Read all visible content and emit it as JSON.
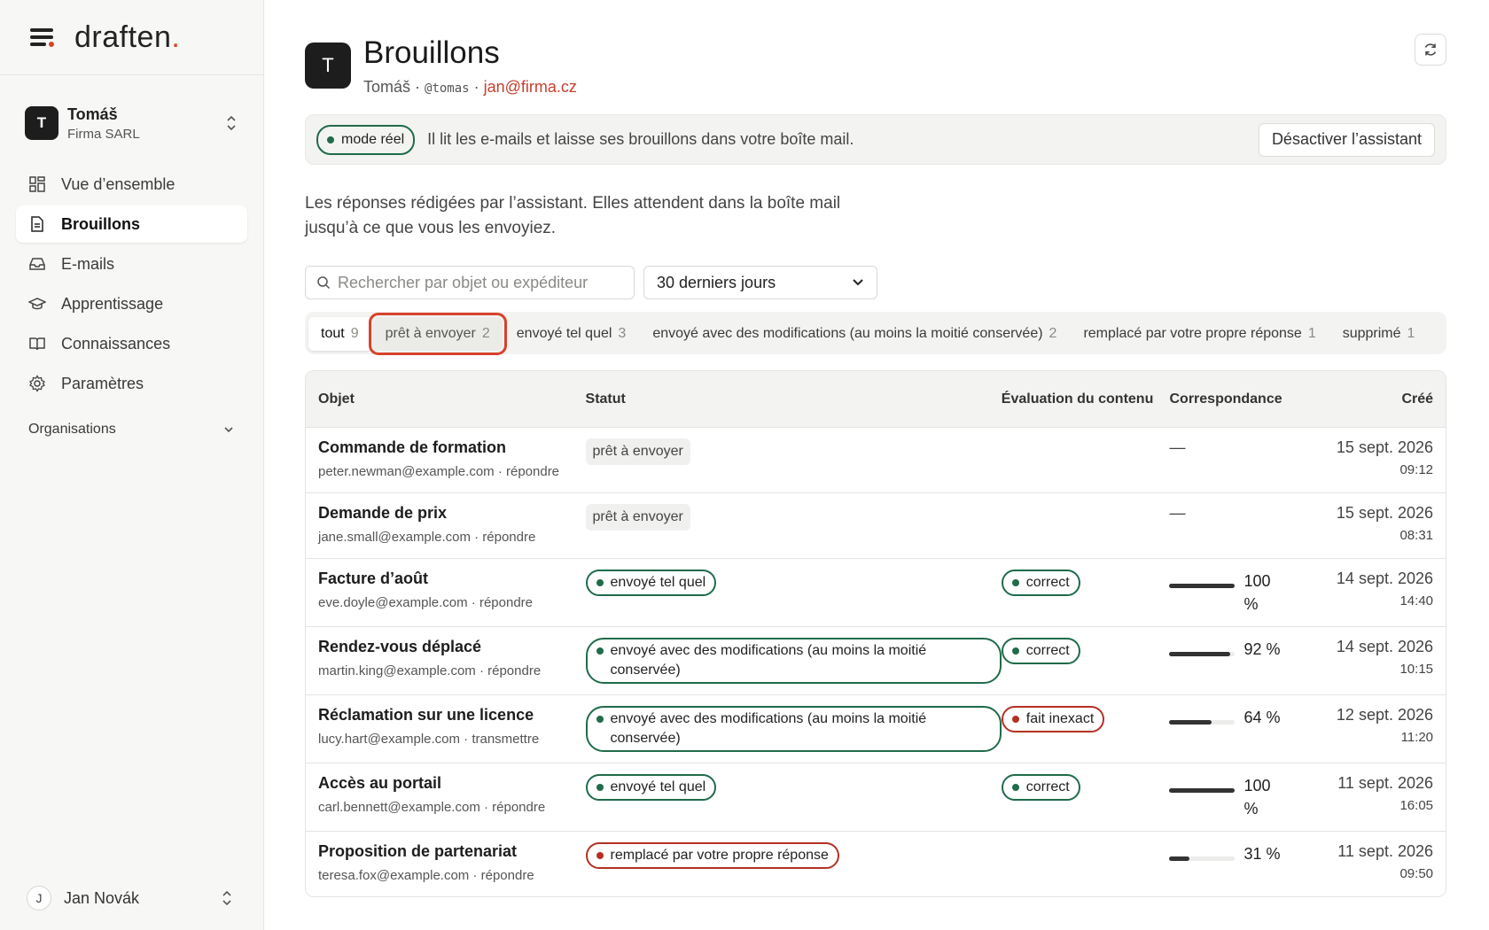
{
  "brand": {
    "name": "draften",
    "dot": ".",
    "accent": "#d8422b"
  },
  "account": {
    "initial": "T",
    "name": "Tomáš",
    "org": "Firma SARL"
  },
  "nav": [
    {
      "label": "Vue d’ensemble",
      "icon": "grid-icon"
    },
    {
      "label": "Brouillons",
      "icon": "document-icon",
      "active": true
    },
    {
      "label": "E-mails",
      "icon": "inbox-icon"
    },
    {
      "label": "Apprentissage",
      "icon": "graduation-cap-icon"
    },
    {
      "label": "Connaissances",
      "icon": "book-icon"
    },
    {
      "label": "Paramètres",
      "icon": "gear-icon"
    }
  ],
  "organisations_label": "Organisations",
  "user": {
    "initial": "J",
    "name": "Jan Novák"
  },
  "header": {
    "initial": "T",
    "title": "Brouillons",
    "name": "Tomáš",
    "sep1": " · ",
    "handle": "@tomas",
    "sep2": " · ",
    "email": "jan@firma.cz"
  },
  "mode_bar": {
    "pill": "mode réel",
    "description": "Il lit les e-mails et laisse ses brouillons dans votre boîte mail.",
    "button": "Désactiver l’assistant"
  },
  "intro": "Les réponses rédigées par l’assistant. Elles attendent dans la boîte mail jusqu’à ce que vous les envoyiez.",
  "search": {
    "placeholder": "Rechercher par objet ou expéditeur"
  },
  "period": {
    "value": "30 derniers jours"
  },
  "tabs": [
    {
      "label": "tout",
      "count": "9"
    },
    {
      "label": "prêt à envoyer",
      "count": "2"
    },
    {
      "label": "envoyé tel quel",
      "count": "3"
    },
    {
      "label": "envoyé avec des modifications (au moins la moitié conservée)",
      "count": "2"
    },
    {
      "label": "remplacé par votre propre réponse",
      "count": "1"
    },
    {
      "label": "supprimé",
      "count": "1"
    }
  ],
  "table": {
    "headers": [
      "Objet",
      "Statut",
      "Évaluation du contenu",
      "Correspondance",
      "Créé"
    ],
    "rows": [
      {
        "subject": "Commande de formation",
        "sender": "peter.newman@example.com · répondre",
        "status": "prêt à envoyer",
        "eval": "",
        "match": "—",
        "match_value": null,
        "date": "15 sept. 2026",
        "time": "09:12"
      },
      {
        "subject": "Demande de prix",
        "sender": "jane.small@example.com · répondre",
        "status": "prêt à envoyer",
        "eval": "",
        "match": "—",
        "match_value": null,
        "date": "15 sept. 2026",
        "time": "08:31"
      },
      {
        "subject": "Facture d’août",
        "sender": "eve.doyle@example.com · répondre",
        "status": "envoyé tel quel",
        "eval": "correct",
        "match": "100 %",
        "match_value": 100,
        "date": "14 sept. 2026",
        "time": "14:40"
      },
      {
        "subject": "Rendez-vous déplacé",
        "sender": "martin.king@example.com · répondre",
        "status": "envoyé avec des modifications (au moins la moitié conservée)",
        "eval": "correct",
        "match": "92 %",
        "match_value": 92,
        "date": "14 sept. 2026",
        "time": "10:15"
      },
      {
        "subject": "Réclamation sur une licence",
        "sender": "lucy.hart@example.com · transmettre",
        "status": "envoyé avec des modifications (au moins la moitié conservée)",
        "eval": "fait inexact",
        "match": "64 %",
        "match_value": 64,
        "date": "12 sept. 2026",
        "time": "11:20"
      },
      {
        "subject": "Accès au portail",
        "sender": "carl.bennett@example.com · répondre",
        "status": "envoyé tel quel",
        "eval": "correct",
        "match": "100 %",
        "match_value": 100,
        "date": "11 sept. 2026",
        "time": "16:05"
      },
      {
        "subject": "Proposition de partenariat",
        "sender": "teresa.fox@example.com · répondre",
        "status": "remplacé par votre propre réponse",
        "eval": "",
        "match": "31 %",
        "match_value": 31,
        "date": "11 sept. 2026",
        "time": "09:50"
      }
    ]
  },
  "colors": {
    "green": "#1f6b4a",
    "red": "#b53023",
    "highlight": "#d8422b"
  }
}
